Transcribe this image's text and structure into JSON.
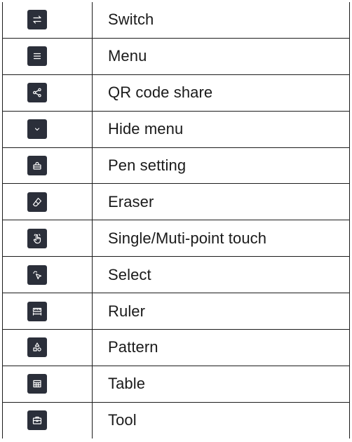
{
  "legend": {
    "rows": [
      {
        "icon": "switch-icon",
        "label": "Switch"
      },
      {
        "icon": "menu-icon",
        "label": "Menu"
      },
      {
        "icon": "share-icon",
        "label": "QR code share"
      },
      {
        "icon": "chevron-down-icon",
        "label": "Hide menu"
      },
      {
        "icon": "pen-icon",
        "label": "Pen setting"
      },
      {
        "icon": "eraser-icon",
        "label": "Eraser"
      },
      {
        "icon": "touch-icon",
        "label": "Single/Muti-point touch"
      },
      {
        "icon": "select-icon",
        "label": "Select"
      },
      {
        "icon": "ruler-icon",
        "label": "Ruler"
      },
      {
        "icon": "shapes-icon",
        "label": "Pattern"
      },
      {
        "icon": "table-icon",
        "label": "Table"
      },
      {
        "icon": "toolbox-icon",
        "label": "Tool"
      }
    ]
  },
  "colors": {
    "icon_background": "#2b2f3a",
    "icon_foreground": "#ffffff",
    "border": "#1c1c1c",
    "text": "#1a1a1a"
  }
}
